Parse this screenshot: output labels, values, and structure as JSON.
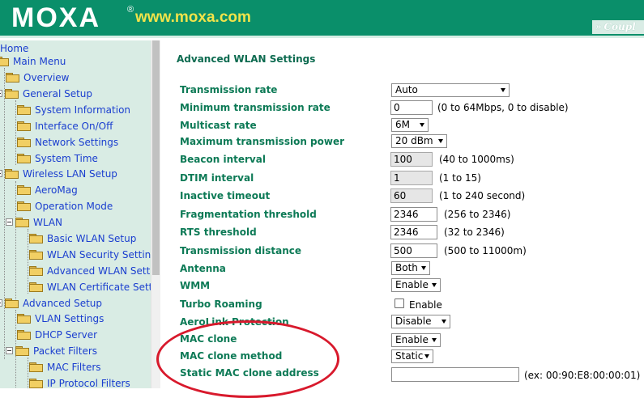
{
  "header": {
    "logo": "MOXA",
    "logo_mark": "®",
    "site_url": "www.moxa.com",
    "tagline": "Coupl",
    "colors": {
      "header_bg": "#0a8f6a",
      "url": "#f0e34a"
    }
  },
  "sidebar": {
    "items": [
      {
        "label": "Home"
      },
      {
        "label": "Main Menu"
      },
      {
        "label": "Overview"
      },
      {
        "label": "General Setup"
      },
      {
        "label": "System Information"
      },
      {
        "label": "Interface On/Off"
      },
      {
        "label": "Network Settings"
      },
      {
        "label": "System Time"
      },
      {
        "label": "Wireless LAN Setup"
      },
      {
        "label": "AeroMag"
      },
      {
        "label": "Operation Mode"
      },
      {
        "label": "WLAN"
      },
      {
        "label": "Basic WLAN Setup"
      },
      {
        "label": "WLAN Security Settings"
      },
      {
        "label": "Advanced WLAN Settings"
      },
      {
        "label": "WLAN Certificate Settings"
      },
      {
        "label": "Advanced Setup"
      },
      {
        "label": "VLAN Settings"
      },
      {
        "label": "DHCP Server"
      },
      {
        "label": "Packet Filters"
      },
      {
        "label": "MAC Filters"
      },
      {
        "label": "IP Protocol Filters"
      }
    ]
  },
  "main": {
    "title": "Advanced WLAN Settings",
    "fields": {
      "transmission_rate": {
        "label": "Transmission rate",
        "value": "Auto"
      },
      "min_transmission_rate": {
        "label": "Minimum transmission rate",
        "value": "0",
        "hint": "(0 to 64Mbps, 0 to disable)"
      },
      "multicast_rate": {
        "label": "Multicast rate",
        "value": "6M"
      },
      "max_transmission_power": {
        "label": "Maximum transmission power",
        "value": "20 dBm"
      },
      "beacon_interval": {
        "label": "Beacon interval",
        "value": "100",
        "hint": "(40 to 1000ms)"
      },
      "dtim_interval": {
        "label": "DTIM interval",
        "value": "1",
        "hint": "(1 to 15)"
      },
      "inactive_timeout": {
        "label": "Inactive timeout",
        "value": "60",
        "hint": "(1 to 240 second)"
      },
      "fragmentation_threshold": {
        "label": "Fragmentation threshold",
        "value": "2346",
        "hint": "(256 to 2346)"
      },
      "rts_threshold": {
        "label": "RTS threshold",
        "value": "2346",
        "hint": "(32 to 2346)"
      },
      "transmission_distance": {
        "label": "Transmission distance",
        "value": "500",
        "hint": "(500 to 11000m)"
      },
      "antenna": {
        "label": "Antenna",
        "value": "Both"
      },
      "wmm": {
        "label": "WMM",
        "value": "Enable"
      },
      "turbo_roaming": {
        "label": "Turbo Roaming",
        "checkbox_label": "Enable",
        "checked": false
      },
      "aerolink_protection": {
        "label": "AeroLink Protection",
        "value": "Disable"
      },
      "mac_clone": {
        "label": "MAC clone",
        "value": "Enable"
      },
      "mac_clone_method": {
        "label": "MAC clone method",
        "value": "Static"
      },
      "static_mac_clone_address": {
        "label": "Static MAC clone address",
        "value": "",
        "hint": "(ex: 00:90:E8:00:00:01)"
      }
    },
    "annotation_color": "#d8192c"
  }
}
